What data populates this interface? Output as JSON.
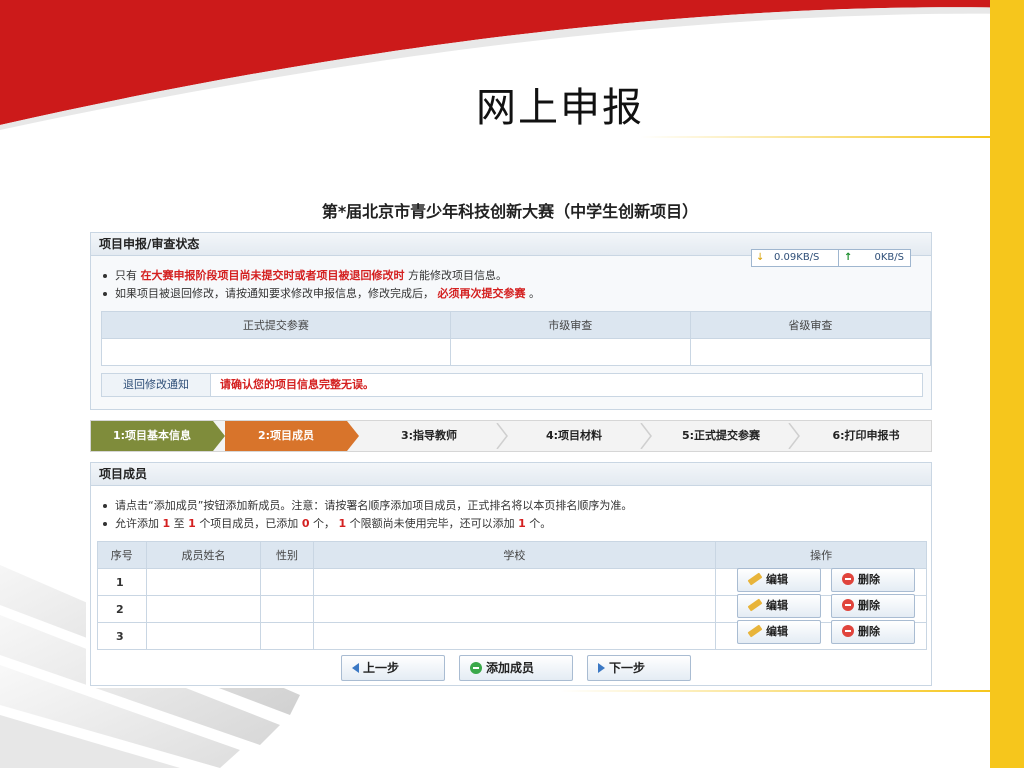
{
  "slide": {
    "title": "网上申报"
  },
  "screen": {
    "title": "第*届北京市青少年科技创新大赛（中学生创新项目）",
    "status": {
      "header": "项目申报/审查状态",
      "speed": {
        "down": "0.09KB/S",
        "up": "0KB/S"
      },
      "note1": {
        "a": "只有",
        "b": "在大赛申报阶段项目尚未提交时或者项目被退回修改时",
        "c": "方能修改项目信息。"
      },
      "note2": {
        "a": "如果项目被退回修改，请按通知要求修改申报信息，修改完成后，",
        "b": "必须再次提交参赛",
        "c": "。"
      },
      "columns": [
        "正式提交参赛",
        "市级审查",
        "省级审查"
      ],
      "notice_label": "退回修改通知",
      "notice_text": "请确认您的项目信息完整无误。"
    },
    "steps": [
      "1:项目基本信息",
      "2:项目成员",
      "3:指导教师",
      "4:项目材料",
      "5:正式提交参赛",
      "6:打印申报书"
    ],
    "active_step": 2,
    "members": {
      "header": "项目成员",
      "note1": "请点击“添加成员”按钮添加新成员。注意：请按署名顺序添加项目成员，正式排名将以本页排名顺序为准。",
      "note2": {
        "a": "允许添加",
        "n1": "1",
        "b": "至",
        "n2": "1",
        "c": "个项目成员，已添加",
        "n3": "0",
        "d": "个，",
        "n4": "1",
        "e": "个限额尚未使用完毕，还可以添加",
        "n5": "1",
        "f": "个。"
      },
      "columns": [
        "序号",
        "成员姓名",
        "性别",
        "学校",
        "操作"
      ],
      "rows": [
        {
          "no": "1",
          "name": "",
          "gender": "",
          "school": ""
        },
        {
          "no": "2",
          "name": "",
          "gender": "",
          "school": ""
        },
        {
          "no": "3",
          "name": "",
          "gender": "",
          "school": ""
        }
      ],
      "edit_label": "编辑",
      "delete_label": "删除"
    },
    "buttons": {
      "prev": "上一步",
      "add": "添加成员",
      "next": "下一步"
    }
  }
}
